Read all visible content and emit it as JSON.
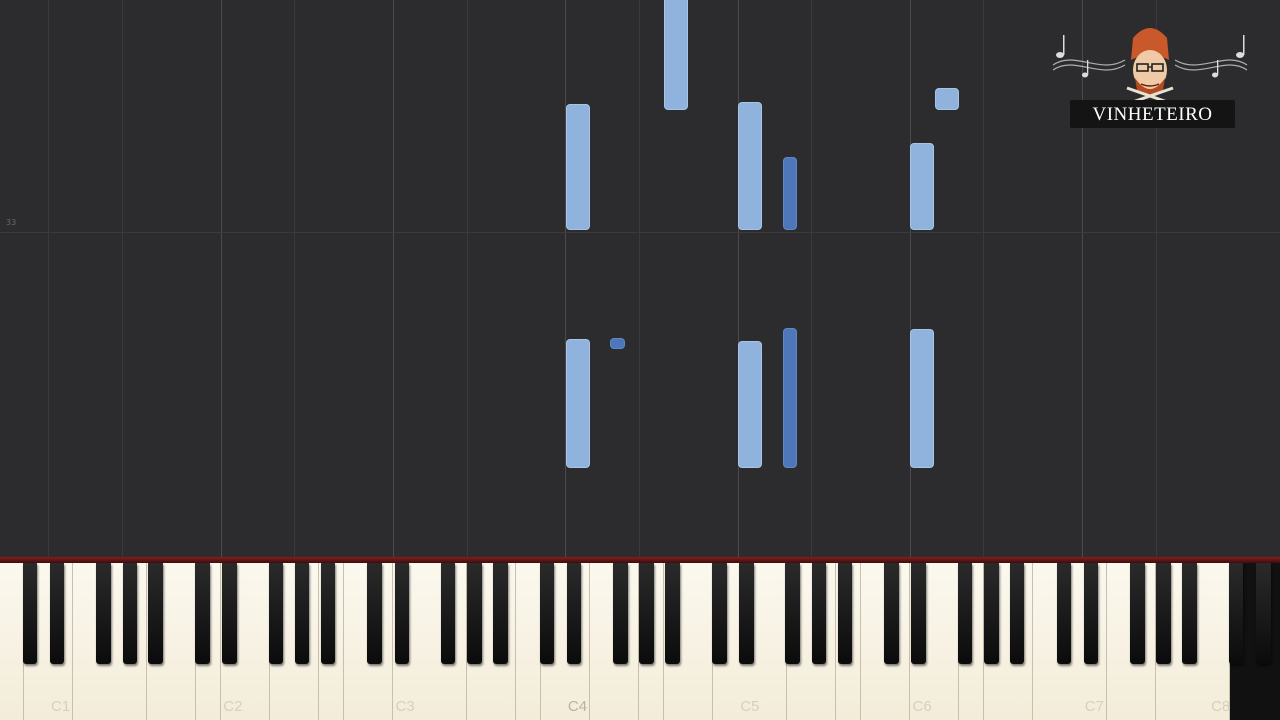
{
  "app": {
    "name": "Synthesia-style piano roll"
  },
  "piano_roll": {
    "measure_number": "33",
    "notes": [
      {
        "pitch": "C4",
        "color": "light",
        "track": "right-hand"
      },
      {
        "pitch": "E4",
        "color": "light",
        "track": "right-hand"
      },
      {
        "pitch": "C5",
        "color": "light",
        "track": "right-hand"
      },
      {
        "pitch": "D5",
        "color": "dark",
        "track": "left-hand"
      },
      {
        "pitch": "C6",
        "color": "light",
        "track": "right-hand"
      },
      {
        "pitch": "D6",
        "color": "light",
        "track": "right-hand"
      },
      {
        "pitch": "C4",
        "color": "light",
        "track": "right-hand"
      },
      {
        "pitch": "D4",
        "color": "dark",
        "track": "left-hand"
      },
      {
        "pitch": "C5",
        "color": "light",
        "track": "right-hand"
      },
      {
        "pitch": "D5",
        "color": "dark",
        "track": "left-hand"
      },
      {
        "pitch": "C6",
        "color": "light",
        "track": "right-hand"
      }
    ],
    "colors": {
      "light_track": "#8fb3dc",
      "dark_track": "#4d77b8",
      "background": "#2c2c2f"
    }
  },
  "keyboard": {
    "octave_labels": [
      "C1",
      "C2",
      "C3",
      "C4",
      "C5",
      "C6",
      "C7",
      "C8"
    ]
  },
  "watermark": {
    "text": "VINHETEIRO",
    "icon": "cartoon-avatar-with-music-notes-icon"
  }
}
